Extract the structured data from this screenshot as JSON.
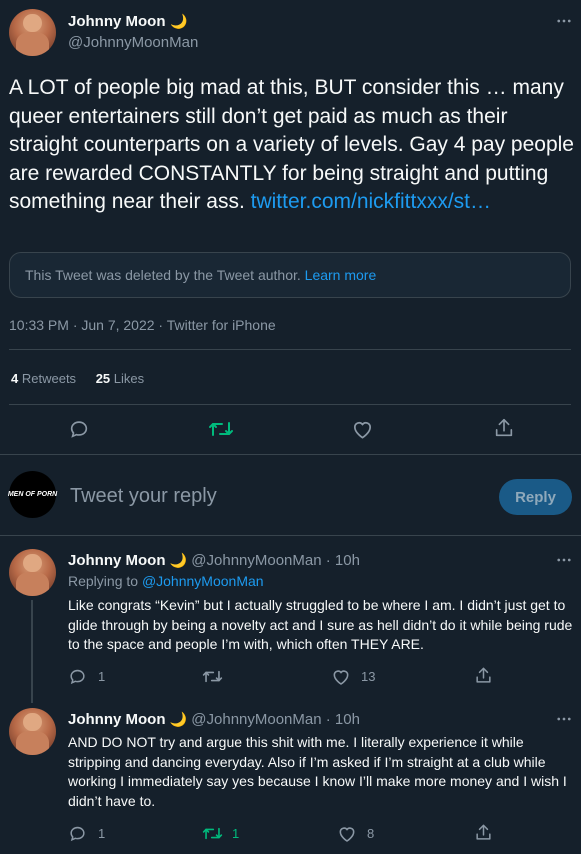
{
  "main_tweet": {
    "name": "Johnny Moon",
    "name_emoji": "🌙",
    "handle": "@JohnnyMoonMan",
    "text": "A LOT of people big mad at this, BUT consider this … many queer entertainers still don’t get paid as much as their straight counterparts on a variety of levels. Gay 4 pay people are rewarded CONSTANTLY for being straight and putting something near their ass.",
    "link": "twitter.com/nickfittxxx/st…",
    "deleted_notice": "This Tweet was deleted by the Tweet author.",
    "learn_more": "Learn more",
    "timestamp": "10:33 PM · Jun 7, 2022 · Twitter for iPhone",
    "retweets_count": "4",
    "retweets_label": "Retweets",
    "likes_count": "25",
    "likes_label": "Likes"
  },
  "reply_box": {
    "avatar_text": "MEN OF PORN",
    "placeholder": "Tweet your reply",
    "button": "Reply"
  },
  "replies": [
    {
      "name": "Johnny Moon",
      "name_emoji": "🌙",
      "handle_time": "@JohnnyMoonMan · 10h",
      "replying_prefix": "Replying to ",
      "replying_to": "@JohnnyMoonMan",
      "text": "Like congrats “Kevin” but I actually struggled to be where I am. I didn’t just get to glide through by being a novelty act and I sure as hell didn’t do it while being rude to the space and people I’m with, which often THEY ARE.",
      "reply_count": "1",
      "retweet_count": "",
      "like_count": "13"
    },
    {
      "name": "Johnny Moon",
      "name_emoji": "🌙",
      "handle_time": "@JohnnyMoonMan · 10h",
      "text": "AND DO NOT try and argue this shit with me. I literally experience it while stripping and dancing everyday. Also if I’m asked if I’m straight at a club while working I immediately say yes because I know I’ll make more money and I wish I didn’t have to.",
      "reply_count": "1",
      "retweet_count": "1",
      "like_count": "8"
    }
  ],
  "colors": {
    "background": "#15202b",
    "text": "#f7f9f9",
    "muted": "#8b98a5",
    "accent": "#1d9bf0",
    "retweet": "#00ba7c",
    "border": "#38444d"
  },
  "icons": [
    "more-icon",
    "reply-icon",
    "retweet-icon",
    "like-icon",
    "share-icon"
  ]
}
